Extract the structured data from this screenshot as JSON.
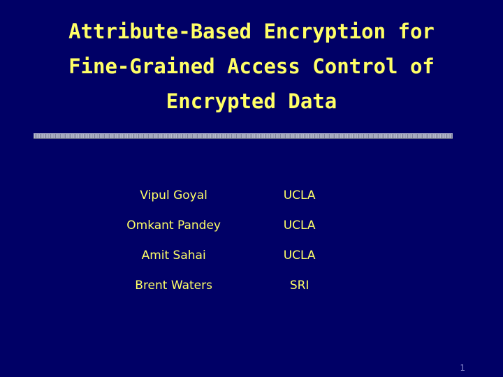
{
  "slide": {
    "title_lines": [
      "Attribute-Based Encryption for",
      "Fine-Grained Access Control of",
      "Encrypted Data"
    ],
    "authors": [
      {
        "name": "Vipul Goyal",
        "affiliation": "UCLA"
      },
      {
        "name": "Omkant Pandey",
        "affiliation": "UCLA"
      },
      {
        "name": "Amit Sahai",
        "affiliation": "UCLA"
      },
      {
        "name": "Brent Waters",
        "affiliation": "SRI"
      }
    ],
    "page_number": "1"
  },
  "colors": {
    "background": "#000066",
    "text": "#ffff66",
    "page_number": "#8888cc"
  }
}
